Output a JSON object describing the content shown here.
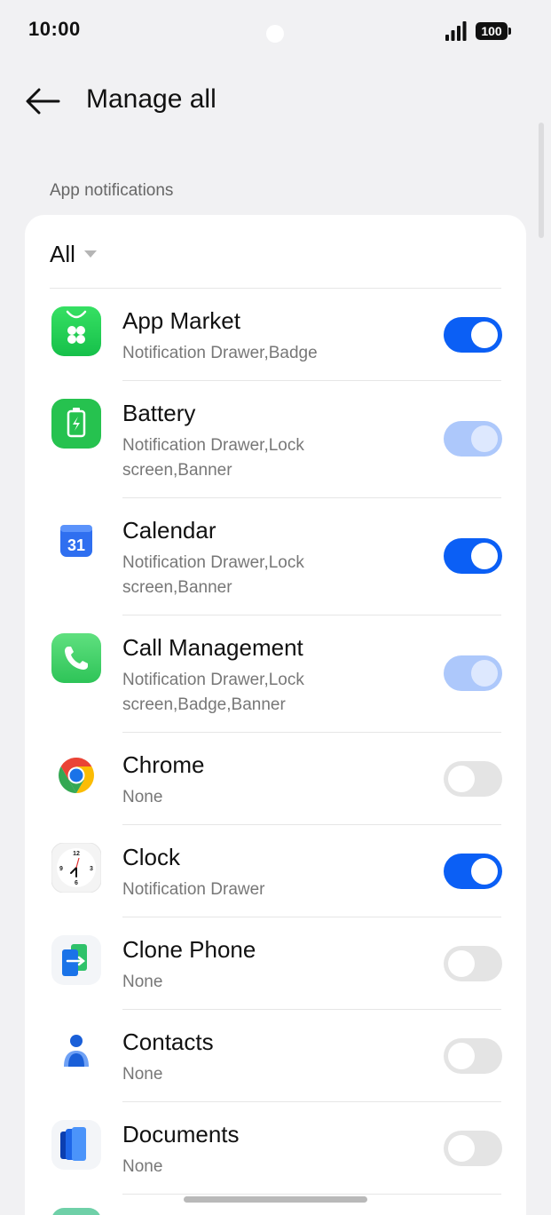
{
  "status": {
    "time": "10:00",
    "battery": "100"
  },
  "header": {
    "title": "Manage all"
  },
  "section": {
    "label": "App notifications"
  },
  "filter": {
    "label": "All"
  },
  "apps": [
    {
      "name": "App Market",
      "sub": "Notification Drawer,Badge",
      "toggle": "on",
      "icon": "app-market-icon"
    },
    {
      "name": "Battery",
      "sub": "Notification Drawer,Lock screen,Banner",
      "toggle": "on-disabled",
      "icon": "battery-app-icon"
    },
    {
      "name": "Calendar",
      "sub": "Notification Drawer,Lock screen,Banner",
      "toggle": "on",
      "icon": "calendar-icon",
      "icon_text": "31"
    },
    {
      "name": "Call Management",
      "sub": "Notification Drawer,Lock screen,Badge,Banner",
      "toggle": "on-disabled",
      "icon": "phone-icon"
    },
    {
      "name": "Chrome",
      "sub": "None",
      "toggle": "off",
      "icon": "chrome-icon"
    },
    {
      "name": "Clock",
      "sub": "Notification Drawer",
      "toggle": "on",
      "icon": "clock-icon",
      "icon_numbers": [
        "12",
        "3",
        "6",
        "9"
      ]
    },
    {
      "name": "Clone Phone",
      "sub": "None",
      "toggle": "off",
      "icon": "clone-phone-icon"
    },
    {
      "name": "Contacts",
      "sub": "None",
      "toggle": "off",
      "icon": "contacts-icon"
    },
    {
      "name": "Documents",
      "sub": "None",
      "toggle": "off",
      "icon": "documents-icon"
    }
  ],
  "colors": {
    "accent": "#0b5ff5",
    "accent_disabled": "#adc8fb",
    "toggle_off": "#e4e4e4",
    "background": "#f1f1f3"
  }
}
